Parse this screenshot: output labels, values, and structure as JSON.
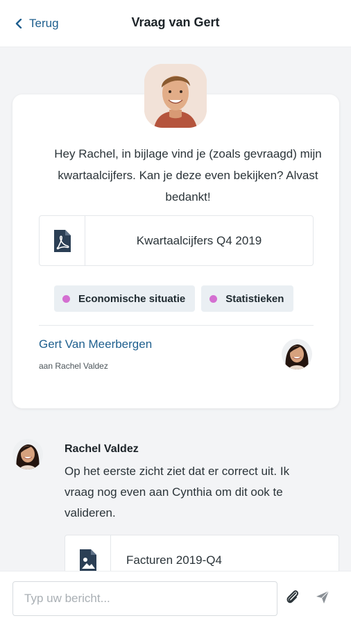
{
  "header": {
    "back_label": "Terug",
    "title": "Vraag van Gert"
  },
  "question": {
    "message": "Hey Rachel, in bijlage vind je (zoals gevraagd) mijn kwartaalcijfers. Kan je deze even bekijken? Alvast bedankt!",
    "attachment": {
      "name": "Kwartaalcijfers Q4 2019",
      "icon": "pdf-icon"
    },
    "tags": [
      {
        "label": "Economische situatie",
        "color": "#d46fd1"
      },
      {
        "label": "Statistieken",
        "color": "#d46fd1"
      }
    ],
    "sender": "Gert Van Meerbergen",
    "recipient": "aan Rachel Valdez"
  },
  "reply": {
    "author": "Rachel Valdez",
    "message": "Op het eerste zicht ziet dat er correct uit. Ik vraag nog even aan Cynthia om dit ook te valideren.",
    "attachment": {
      "name": "Facturen 2019-Q4",
      "icon": "image-file-icon"
    }
  },
  "composer": {
    "placeholder": "Typ uw bericht..."
  },
  "colors": {
    "accent": "#1e5f8e",
    "tag_dot": "#d46fd1"
  }
}
